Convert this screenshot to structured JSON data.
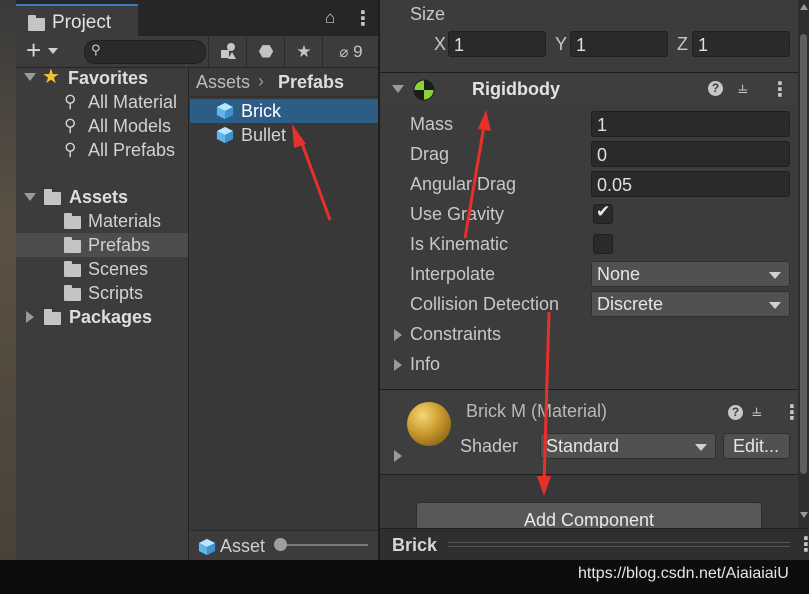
{
  "project": {
    "tab_label": "Project",
    "hidden_count": "9",
    "favorites": {
      "label": "Favorites",
      "items": [
        "All Material",
        "All Models",
        "All Prefabs"
      ]
    },
    "assets": {
      "label": "Assets",
      "children": [
        "Materials",
        "Prefabs",
        "Scenes",
        "Scripts"
      ],
      "selected": "Prefabs"
    },
    "packages_label": "Packages",
    "breadcrumb": {
      "root": "Assets",
      "current": "Prefabs"
    },
    "files": [
      "Brick",
      "Bullet"
    ],
    "selected_file": "Brick",
    "footer_label": "Asset"
  },
  "inspector": {
    "size": {
      "label": "Size",
      "x_label": "X",
      "x": "1",
      "y_label": "Y",
      "y": "1",
      "z_label": "Z",
      "z": "1"
    },
    "rigidbody": {
      "title": "Rigidbody",
      "mass_label": "Mass",
      "mass": "1",
      "drag_label": "Drag",
      "drag": "0",
      "angular_drag_label": "Angular Drag",
      "angular_drag": "0.05",
      "use_gravity_label": "Use Gravity",
      "use_gravity": true,
      "is_kinematic_label": "Is Kinematic",
      "is_kinematic": false,
      "interpolate_label": "Interpolate",
      "interpolate": "None",
      "collision_label": "Collision Detection",
      "collision": "Discrete",
      "constraints_label": "Constraints",
      "info_label": "Info"
    },
    "material": {
      "title": "Brick M (Material)",
      "shader_label": "Shader",
      "shader": "Standard",
      "edit_label": "Edit..."
    },
    "add_component_label": "Add Component",
    "footer_title": "Brick"
  },
  "watermark": "https://blog.csdn.net/AiaiaiaiU",
  "colors": {
    "selection": "#2c5d87",
    "accent": "#3a79bb",
    "star": "#f2c230",
    "arrow": "#e8302a"
  }
}
